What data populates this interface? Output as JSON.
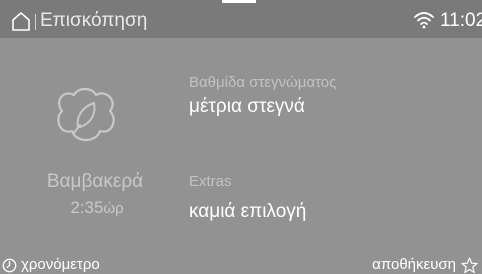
{
  "header": {
    "home_icon": "home-icon",
    "title": "Επισκόπηση",
    "wifi_icon": "wifi-icon",
    "time": "11:02"
  },
  "program": {
    "icon": "cotton-icon",
    "name": "Βαμβακερά",
    "duration_value": "2:35",
    "duration_unit": "ώρ"
  },
  "settings": {
    "dryness": {
      "label": "Βαθμίδα στεγνώματος",
      "value": "μέτρια στεγνά"
    },
    "extras": {
      "label": "Extras",
      "value": "καμιά επιλογή"
    }
  },
  "footer": {
    "timer_icon": "clock-icon",
    "timer_label": "χρονόμετρο",
    "save_label": "αποθήκευση",
    "save_icon": "star-icon"
  },
  "colors": {
    "background": "#929292",
    "header_background": "#7a7a7a",
    "text_primary": "#ffffff",
    "text_secondary": "#c2c2c2"
  }
}
